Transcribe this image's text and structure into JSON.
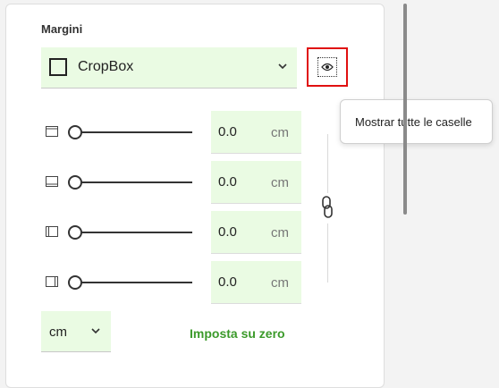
{
  "margins": {
    "title": "Margini",
    "box_select": {
      "value": "CropBox"
    },
    "preview_tooltip": "Mostrar tutte le caselle",
    "rows": [
      {
        "side": "top",
        "icon": "margin-top-icon",
        "value": "0.0",
        "unit": "cm",
        "slider_fraction": 0
      },
      {
        "side": "bottom",
        "icon": "margin-bottom-icon",
        "value": "0.0",
        "unit": "cm",
        "slider_fraction": 0
      },
      {
        "side": "left",
        "icon": "margin-left-icon",
        "value": "0.0",
        "unit": "cm",
        "slider_fraction": 0
      },
      {
        "side": "right",
        "icon": "margin-right-icon",
        "value": "0.0",
        "unit": "cm",
        "slider_fraction": 0
      }
    ],
    "unit_select": {
      "value": "cm"
    },
    "reset_label": "Imposta su zero"
  },
  "colors": {
    "field_bg": "#eafbe3",
    "accent_green": "#3b9a2a",
    "highlight_red": "#e01010"
  }
}
